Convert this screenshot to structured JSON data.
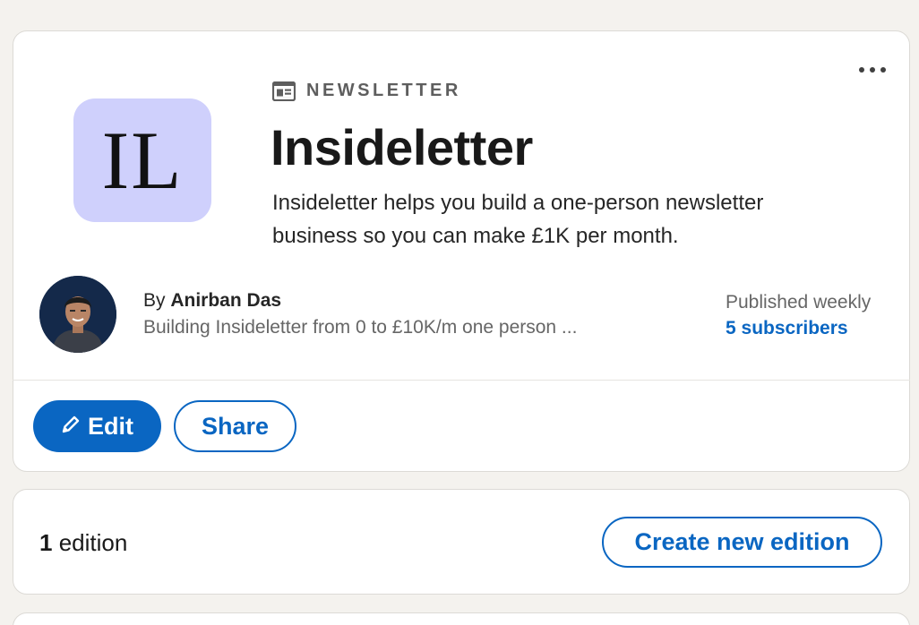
{
  "newsletter": {
    "kicker": "NEWSLETTER",
    "kicker_icon": "newsletter-icon",
    "logo_text": "IL",
    "logo_bg": "#cfd0fc",
    "title": "Insideletter",
    "description": "Insideletter helps you build a one-person newsletter business so you can make £1K per month."
  },
  "author": {
    "by_label": "By",
    "name": "Anirban Das",
    "headline": "Building Insideletter from 0 to £10K/m one person ..."
  },
  "meta": {
    "frequency": "Published weekly",
    "subscribers": "5 subscribers"
  },
  "actions": {
    "edit_label": "Edit",
    "edit_icon": "pencil-icon",
    "share_label": "Share",
    "more_icon": "more-options-icon"
  },
  "editions": {
    "count": "1",
    "label": "edition",
    "create_label": "Create new edition"
  },
  "colors": {
    "accent": "#0a66c2",
    "background": "#f4f2ee"
  }
}
